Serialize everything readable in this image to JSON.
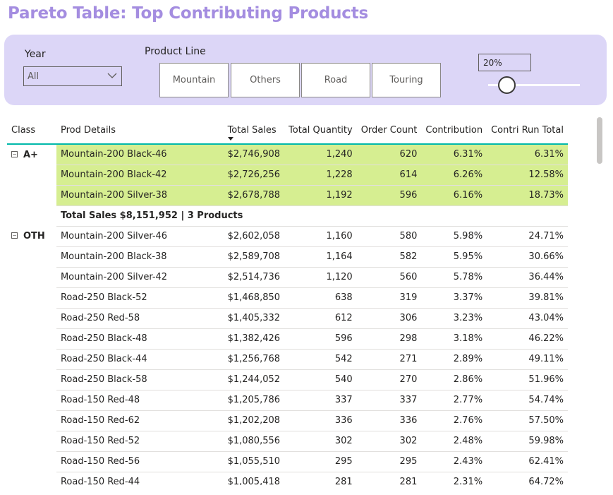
{
  "title": "Pareto Table: Top Contributing Products",
  "filters": {
    "year_label": "Year",
    "year_value": "All",
    "product_line_label": "Product Line",
    "product_lines": [
      "Mountain",
      "Others",
      "Road",
      "Touring"
    ],
    "threshold_value": "20%",
    "threshold_slider_level": 0.2
  },
  "table": {
    "columns": [
      "Class",
      "Prod Details",
      "Total Sales",
      "Total Quantity",
      "Order Count",
      "Contribution",
      "Contri Run Total"
    ],
    "sorted_column": "Total Sales",
    "highlight_color": "#d6ee91",
    "groups": [
      {
        "class": "A+",
        "rows": [
          [
            "Mountain-200 Black-46",
            "$2,746,908",
            "1,240",
            "620",
            "6.31%",
            "6.31%"
          ],
          [
            "Mountain-200 Black-42",
            "$2,726,256",
            "1,228",
            "614",
            "6.26%",
            "12.58%"
          ],
          [
            "Mountain-200 Silver-38",
            "$2,678,788",
            "1,192",
            "596",
            "6.16%",
            "18.73%"
          ]
        ],
        "total": "Total Sales $8,151,952 | 3 Products"
      },
      {
        "class": "OTH",
        "rows": [
          [
            "Mountain-200 Silver-46",
            "$2,602,058",
            "1,160",
            "580",
            "5.98%",
            "24.71%"
          ],
          [
            "Mountain-200 Black-38",
            "$2,589,708",
            "1,164",
            "582",
            "5.95%",
            "30.66%"
          ],
          [
            "Mountain-200 Silver-42",
            "$2,514,736",
            "1,120",
            "560",
            "5.78%",
            "36.44%"
          ],
          [
            "Road-250 Black-52",
            "$1,468,850",
            "638",
            "319",
            "3.37%",
            "39.81%"
          ],
          [
            "Road-250 Red-58",
            "$1,405,332",
            "612",
            "306",
            "3.23%",
            "43.04%"
          ],
          [
            "Road-250 Black-48",
            "$1,382,426",
            "596",
            "298",
            "3.18%",
            "46.22%"
          ],
          [
            "Road-250 Black-44",
            "$1,256,768",
            "542",
            "271",
            "2.89%",
            "49.11%"
          ],
          [
            "Road-250 Black-58",
            "$1,244,052",
            "540",
            "270",
            "2.86%",
            "51.96%"
          ],
          [
            "Road-150 Red-48",
            "$1,205,786",
            "337",
            "337",
            "2.77%",
            "54.74%"
          ],
          [
            "Road-150 Red-62",
            "$1,202,208",
            "336",
            "336",
            "2.76%",
            "57.50%"
          ],
          [
            "Road-150 Red-52",
            "$1,080,556",
            "302",
            "302",
            "2.48%",
            "59.98%"
          ],
          [
            "Road-150 Red-56",
            "$1,055,510",
            "295",
            "295",
            "2.43%",
            "62.41%"
          ],
          [
            "Road-150 Red-44",
            "$1,005,418",
            "281",
            "281",
            "2.31%",
            "64.72%"
          ]
        ]
      }
    ]
  }
}
